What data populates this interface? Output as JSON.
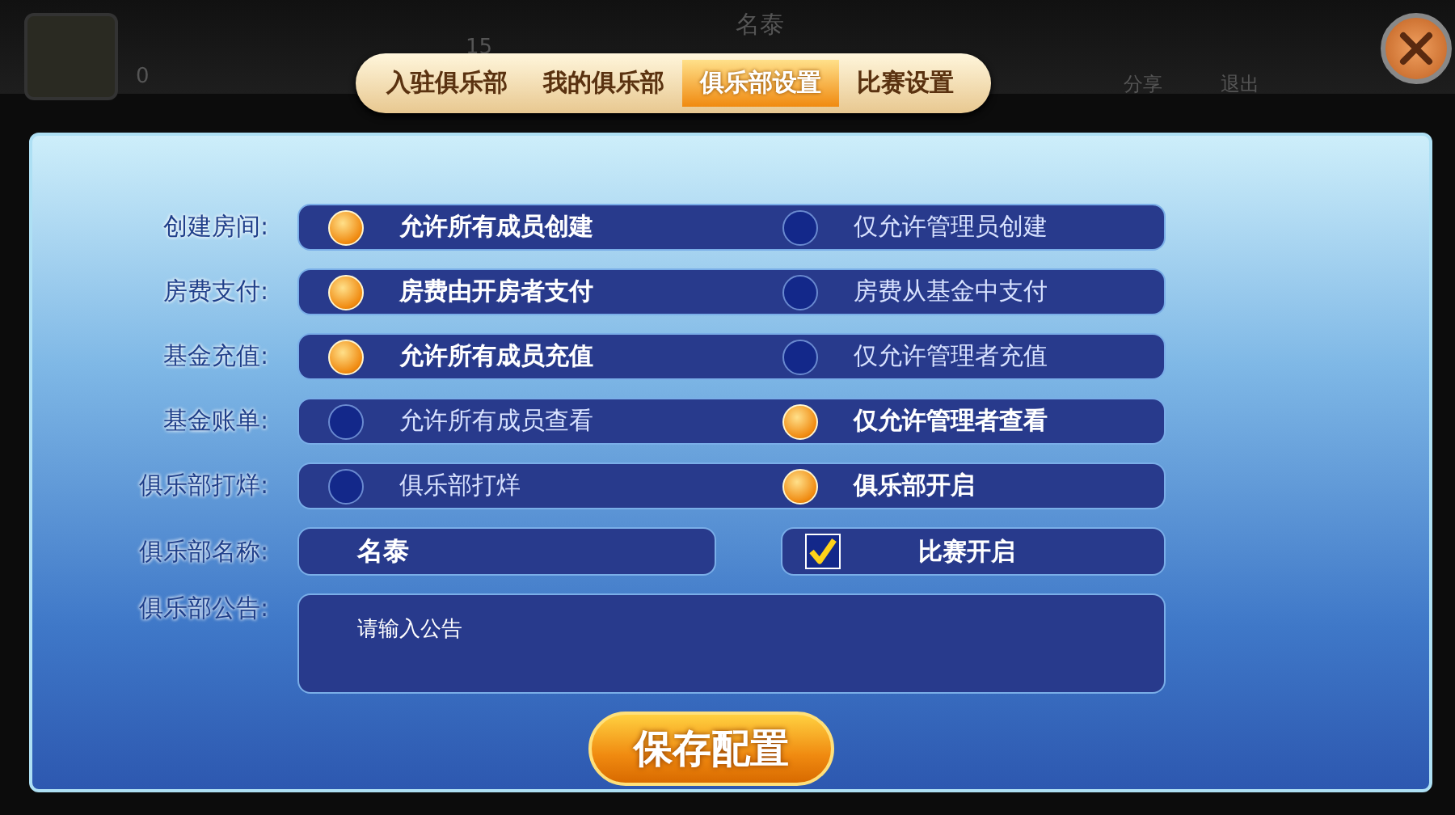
{
  "background": {
    "user_value": "0",
    "count": "15",
    "name": "名泰",
    "buttons": [
      "分享",
      "退出"
    ]
  },
  "tabs": [
    {
      "label": "入驻俱乐部",
      "selected": false
    },
    {
      "label": "我的俱乐部",
      "selected": false
    },
    {
      "label": "俱乐部设置",
      "selected": true
    },
    {
      "label": "比赛设置",
      "selected": false
    }
  ],
  "settings": [
    {
      "label": "创建房间:",
      "options": [
        {
          "label": "允许所有成员创建",
          "selected": true
        },
        {
          "label": "仅允许管理员创建",
          "selected": false
        }
      ]
    },
    {
      "label": "房费支付:",
      "options": [
        {
          "label": "房费由开房者支付",
          "selected": true
        },
        {
          "label": "房费从基金中支付",
          "selected": false
        }
      ]
    },
    {
      "label": "基金充值:",
      "options": [
        {
          "label": "允许所有成员充值",
          "selected": true
        },
        {
          "label": "仅允许管理者充值",
          "selected": false
        }
      ]
    },
    {
      "label": "基金账单:",
      "options": [
        {
          "label": "允许所有成员查看",
          "selected": false
        },
        {
          "label": "仅允许管理者查看",
          "selected": true
        }
      ]
    },
    {
      "label": "俱乐部打烊:",
      "options": [
        {
          "label": "俱乐部打烊",
          "selected": false
        },
        {
          "label": "俱乐部开启",
          "selected": true
        }
      ]
    }
  ],
  "club_name": {
    "label": "俱乐部名称:",
    "value": "名泰"
  },
  "match_toggle": {
    "label": "比赛开启",
    "checked": true
  },
  "notice": {
    "label": "俱乐部公告:",
    "placeholder": "请输入公告"
  },
  "save_button": "保存配置"
}
